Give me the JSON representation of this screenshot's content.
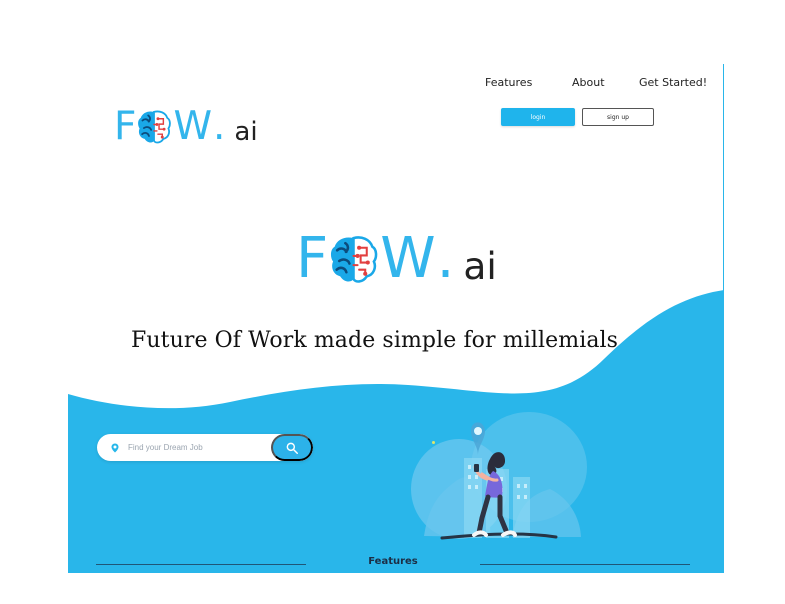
{
  "brand": {
    "name_prefix": "F",
    "name_suffix": "W",
    "dot": ".",
    "ai": "ai",
    "accent_color": "#33b5ec",
    "brain_icon": "brain-icon"
  },
  "nav": {
    "features": "Features",
    "about": "About",
    "get_started": "Get Started!"
  },
  "auth": {
    "login": "login",
    "signup": "sign up"
  },
  "hero": {
    "headline": "Future Of Work made simple for millemials"
  },
  "search": {
    "placeholder": "Find your Dream Job",
    "pin_icon": "map-pin-icon",
    "button_icon": "search-icon"
  },
  "illustration": {
    "name": "person-with-phone-illustration",
    "location_icon": "location-pin-icon"
  },
  "section": {
    "features_label": "Features"
  },
  "colors": {
    "hero_blue": "#29b6ea",
    "button_blue": "#1fb4ec",
    "text_dark": "#111111",
    "border": "#29b6ea"
  }
}
